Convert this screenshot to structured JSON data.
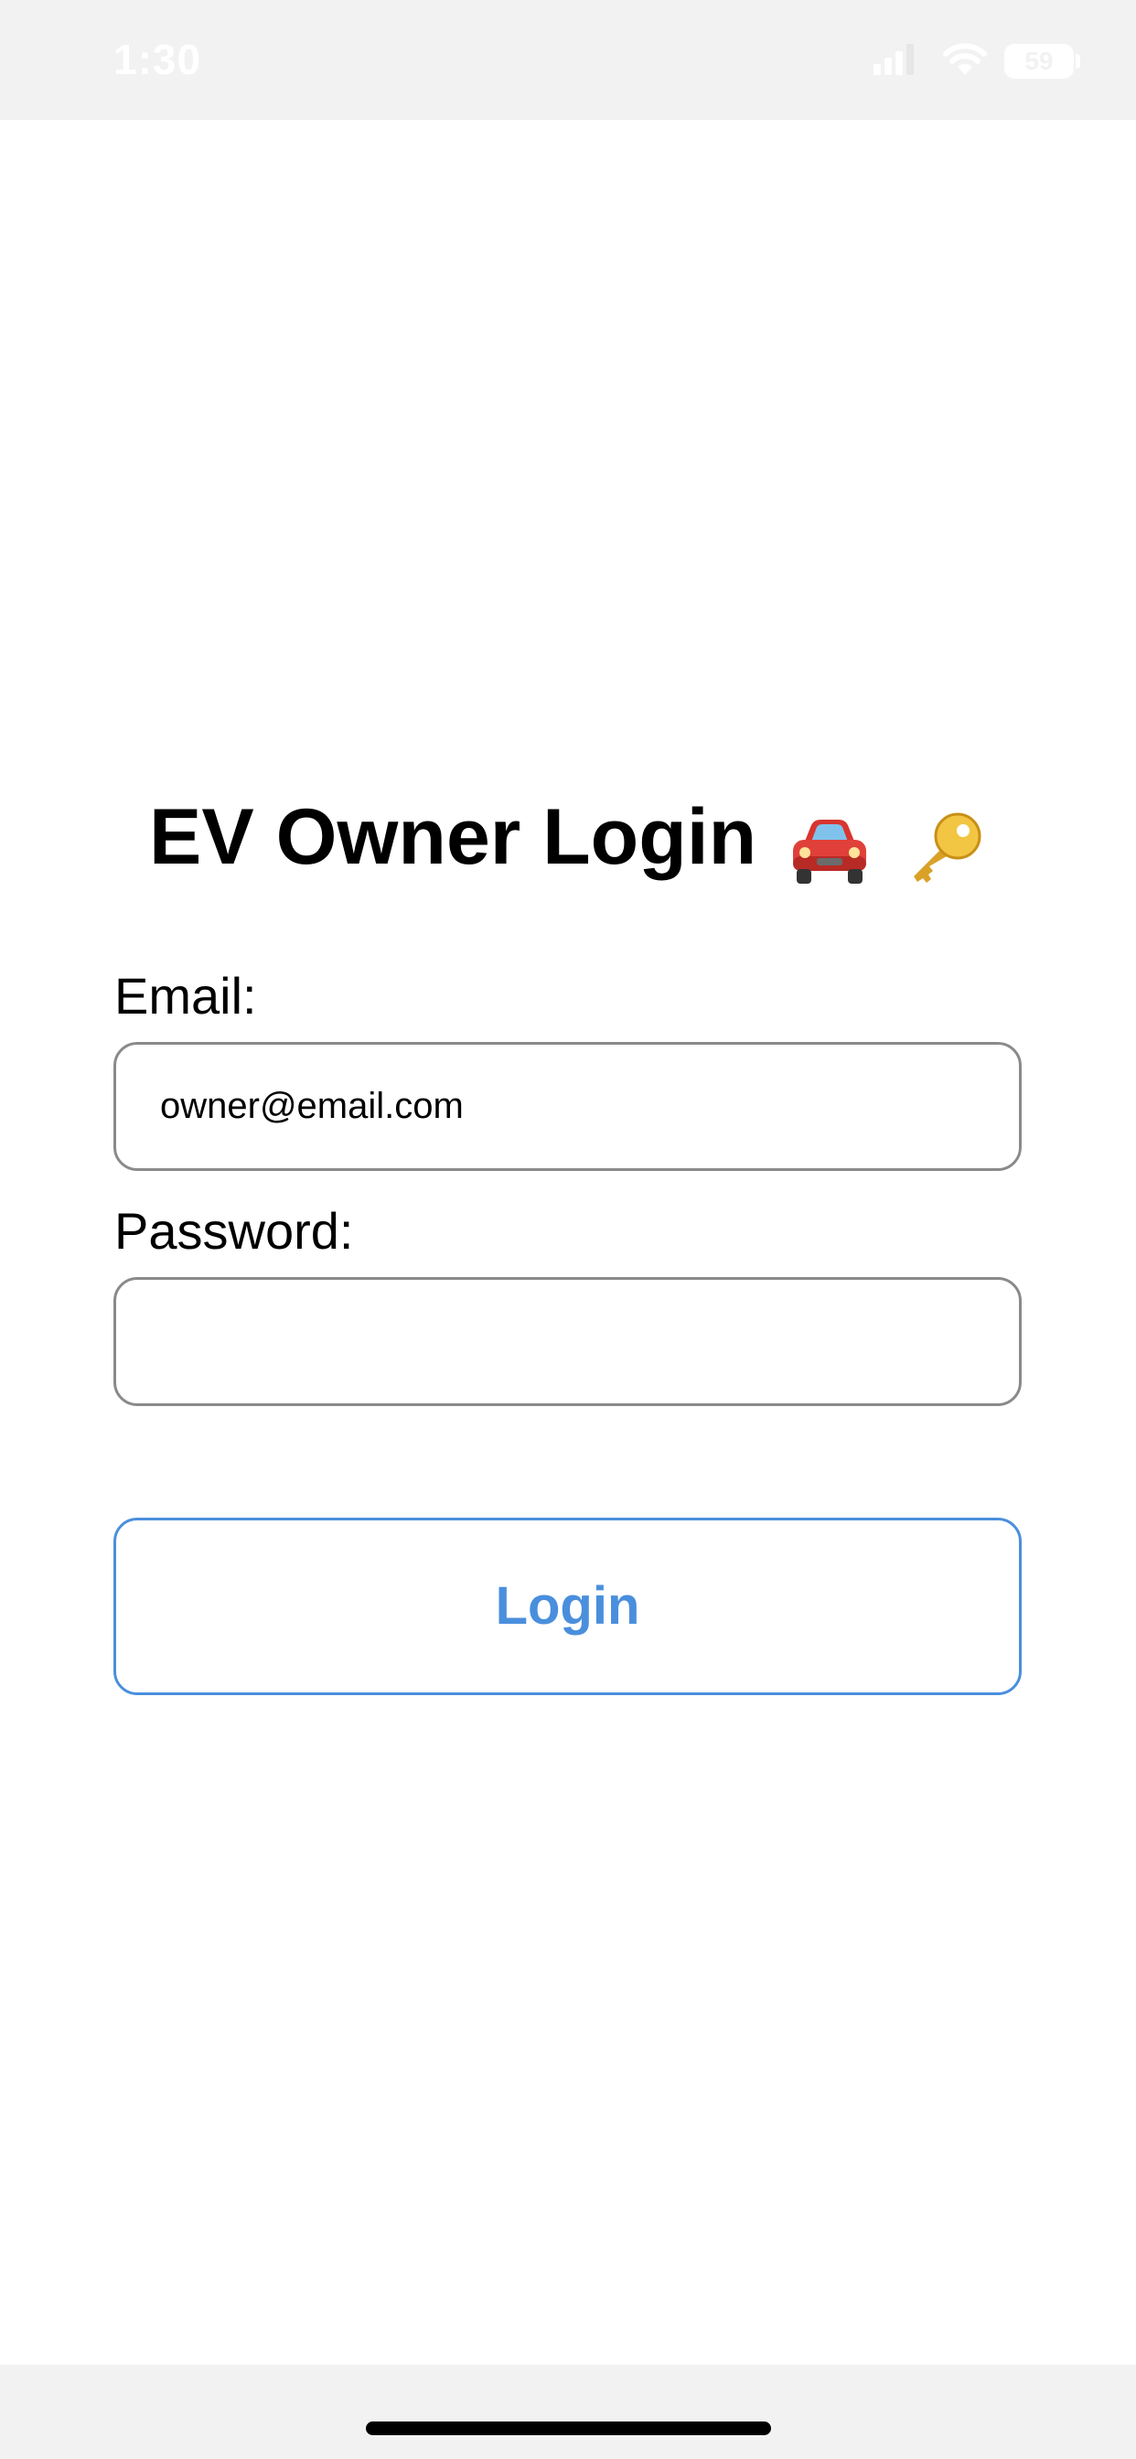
{
  "status_bar": {
    "time": "1:30",
    "battery_level": "59",
    "icons": [
      "signal-icon",
      "wifi-icon",
      "battery-icon"
    ]
  },
  "login": {
    "title": "EV Owner Login",
    "title_icons": [
      "car-icon",
      "key-icon"
    ],
    "email_label": "Email:",
    "email_value": "owner@email.com",
    "password_label": "Password:",
    "password_value": "",
    "button_label": "Login"
  },
  "colors": {
    "accent": "#4a8fdd",
    "input_border": "#8a8a8a",
    "system_bar_bg": "#f2f2f2"
  }
}
